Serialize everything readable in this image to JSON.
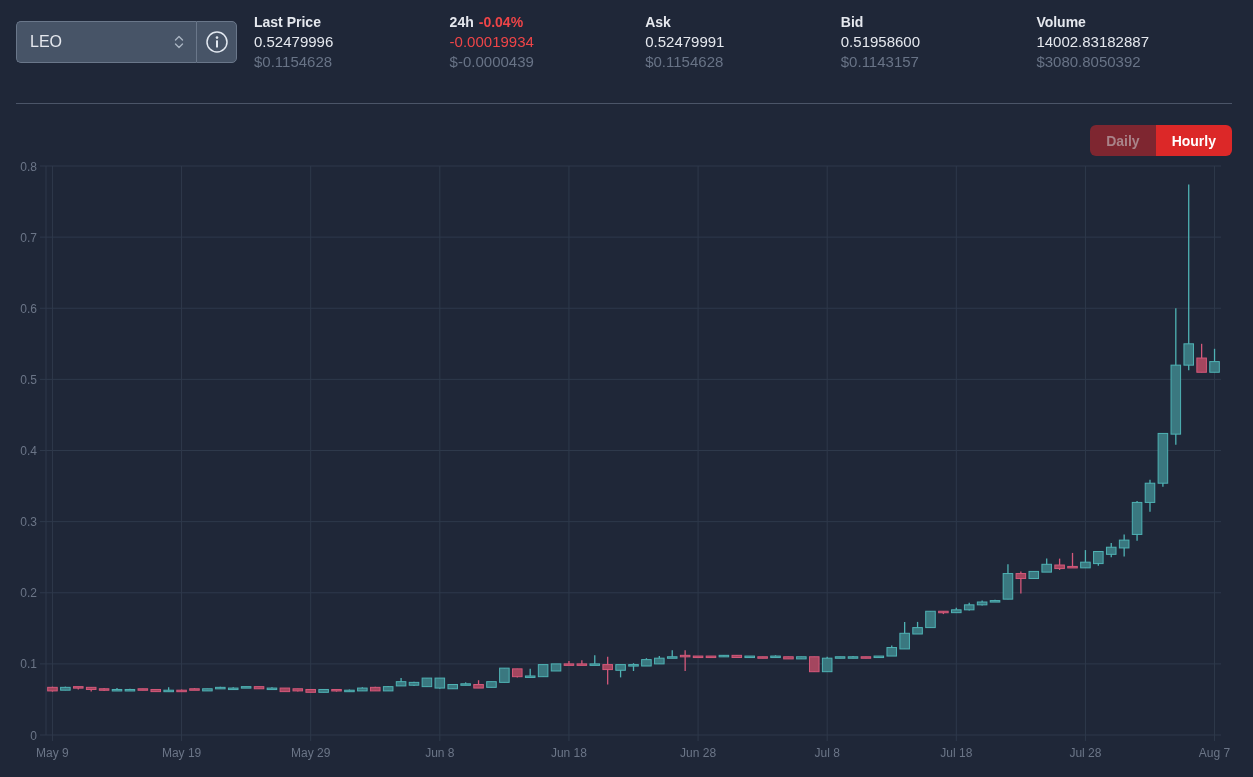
{
  "pair_selector": {
    "value": "LEO"
  },
  "stats": [
    {
      "label": "Last Price",
      "value": "0.52479996",
      "usd": "$0.1154628",
      "negative": false
    },
    {
      "label": "24h",
      "change": "-0.04%",
      "value": "-0.00019934",
      "usd": "$-0.0000439",
      "negative": true
    },
    {
      "label": "Ask",
      "value": "0.52479991",
      "usd": "$0.1154628",
      "negative": false
    },
    {
      "label": "Bid",
      "value": "0.51958600",
      "usd": "$0.1143157",
      "negative": false
    },
    {
      "label": "Volume",
      "value": "14002.83182887",
      "usd": "$3080.8050392",
      "negative": false
    }
  ],
  "interval_toggle": [
    {
      "label": "Daily",
      "selected": false
    },
    {
      "label": "Hourly",
      "selected": true
    }
  ],
  "chart": {
    "chart_data": {
      "type": "candlestick",
      "grid": true,
      "ylim": [
        0,
        0.8
      ],
      "yticks": [
        0,
        0.1,
        0.2,
        0.3,
        0.4,
        0.5,
        0.6,
        0.7,
        0.8
      ],
      "categories": [
        "May 9",
        null,
        null,
        null,
        null,
        null,
        null,
        null,
        null,
        null,
        "May 19",
        null,
        null,
        null,
        null,
        null,
        null,
        null,
        null,
        null,
        "May 29",
        null,
        null,
        null,
        null,
        null,
        null,
        null,
        null,
        null,
        "Jun 8",
        null,
        null,
        null,
        null,
        null,
        null,
        null,
        null,
        null,
        "Jun 18",
        null,
        null,
        null,
        null,
        null,
        null,
        null,
        null,
        null,
        "Jun 28",
        null,
        null,
        null,
        null,
        null,
        null,
        null,
        null,
        null,
        "Jul 8",
        null,
        null,
        null,
        null,
        null,
        null,
        null,
        null,
        null,
        "Jul 18",
        null,
        null,
        null,
        null,
        null,
        null,
        null,
        null,
        null,
        "Jul 28",
        null,
        null,
        null,
        null,
        null,
        null,
        null,
        null,
        null,
        "Aug 7"
      ],
      "ohlc": [
        [
          0.067,
          0.068,
          0.061,
          0.062
        ],
        [
          0.063,
          0.068,
          0.063,
          0.067
        ],
        [
          0.068,
          0.068,
          0.064,
          0.066
        ],
        [
          0.067,
          0.067,
          0.061,
          0.064
        ],
        [
          0.065,
          0.066,
          0.062,
          0.063
        ],
        [
          0.063,
          0.066,
          0.062,
          0.064
        ],
        [
          0.063,
          0.065,
          0.062,
          0.064
        ],
        [
          0.065,
          0.065,
          0.063,
          0.064
        ],
        [
          0.064,
          0.064,
          0.061,
          0.061
        ],
        [
          0.061,
          0.067,
          0.061,
          0.063
        ],
        [
          0.063,
          0.064,
          0.061,
          0.062
        ],
        [
          0.065,
          0.066,
          0.064,
          0.064
        ],
        [
          0.062,
          0.065,
          0.062,
          0.065
        ],
        [
          0.065,
          0.068,
          0.065,
          0.067
        ],
        [
          0.064,
          0.067,
          0.064,
          0.066
        ],
        [
          0.066,
          0.068,
          0.066,
          0.068
        ],
        [
          0.068,
          0.068,
          0.065,
          0.065
        ],
        [
          0.065,
          0.067,
          0.065,
          0.066
        ],
        [
          0.066,
          0.066,
          0.061,
          0.061
        ],
        [
          0.065,
          0.065,
          0.061,
          0.062
        ],
        [
          0.064,
          0.064,
          0.06,
          0.06
        ],
        [
          0.06,
          0.064,
          0.06,
          0.064
        ],
        [
          0.064,
          0.064,
          0.061,
          0.062
        ],
        [
          0.062,
          0.064,
          0.061,
          0.063
        ],
        [
          0.062,
          0.067,
          0.062,
          0.066
        ],
        [
          0.067,
          0.068,
          0.062,
          0.062
        ],
        [
          0.062,
          0.069,
          0.062,
          0.068
        ],
        [
          0.069,
          0.08,
          0.069,
          0.075
        ],
        [
          0.07,
          0.075,
          0.069,
          0.074
        ],
        [
          0.068,
          0.08,
          0.068,
          0.08
        ],
        [
          0.066,
          0.08,
          0.065,
          0.08
        ],
        [
          0.065,
          0.071,
          0.065,
          0.071
        ],
        [
          0.07,
          0.074,
          0.07,
          0.072
        ],
        [
          0.071,
          0.077,
          0.066,
          0.066
        ],
        [
          0.067,
          0.075,
          0.067,
          0.075
        ],
        [
          0.074,
          0.094,
          0.074,
          0.094
        ],
        [
          0.093,
          0.093,
          0.081,
          0.082
        ],
        [
          0.082,
          0.093,
          0.082,
          0.083
        ],
        [
          0.082,
          0.099,
          0.082,
          0.099
        ],
        [
          0.09,
          0.1,
          0.09,
          0.1
        ],
        [
          0.1,
          0.104,
          0.099,
          0.099
        ],
        [
          0.1,
          0.105,
          0.098,
          0.098
        ],
        [
          0.099,
          0.112,
          0.099,
          0.1
        ],
        [
          0.099,
          0.11,
          0.071,
          0.092
        ],
        [
          0.091,
          0.099,
          0.081,
          0.099
        ],
        [
          0.098,
          0.101,
          0.09,
          0.099
        ],
        [
          0.097,
          0.108,
          0.097,
          0.106
        ],
        [
          0.1,
          0.111,
          0.1,
          0.108
        ],
        [
          0.108,
          0.119,
          0.108,
          0.11
        ],
        [
          0.112,
          0.119,
          0.09,
          0.11
        ],
        [
          0.111,
          0.111,
          0.11,
          0.11
        ],
        [
          0.111,
          0.111,
          0.109,
          0.11
        ],
        [
          0.11,
          0.112,
          0.11,
          0.112
        ],
        [
          0.112,
          0.112,
          0.109,
          0.109
        ],
        [
          0.109,
          0.111,
          0.109,
          0.111
        ],
        [
          0.11,
          0.11,
          0.108,
          0.109
        ],
        [
          0.109,
          0.112,
          0.109,
          0.111
        ],
        [
          0.11,
          0.11,
          0.107,
          0.107
        ],
        [
          0.107,
          0.11,
          0.107,
          0.11
        ],
        [
          0.11,
          0.11,
          0.089,
          0.089
        ],
        [
          0.089,
          0.11,
          0.089,
          0.108
        ],
        [
          0.108,
          0.11,
          0.108,
          0.11
        ],
        [
          0.109,
          0.111,
          0.108,
          0.11
        ],
        [
          0.11,
          0.11,
          0.108,
          0.108
        ],
        [
          0.109,
          0.111,
          0.109,
          0.111
        ],
        [
          0.111,
          0.126,
          0.111,
          0.123
        ],
        [
          0.121,
          0.159,
          0.121,
          0.143
        ],
        [
          0.142,
          0.159,
          0.142,
          0.151
        ],
        [
          0.151,
          0.174,
          0.151,
          0.174
        ],
        [
          0.174,
          0.174,
          0.17,
          0.172
        ],
        [
          0.172,
          0.179,
          0.172,
          0.176
        ],
        [
          0.176,
          0.186,
          0.175,
          0.183
        ],
        [
          0.183,
          0.189,
          0.182,
          0.187
        ],
        [
          0.187,
          0.19,
          0.187,
          0.189
        ],
        [
          0.191,
          0.24,
          0.191,
          0.227
        ],
        [
          0.227,
          0.23,
          0.199,
          0.22
        ],
        [
          0.22,
          0.23,
          0.22,
          0.23
        ],
        [
          0.229,
          0.248,
          0.229,
          0.24
        ],
        [
          0.239,
          0.248,
          0.232,
          0.234
        ],
        [
          0.237,
          0.256,
          0.235,
          0.236
        ],
        [
          0.235,
          0.26,
          0.235,
          0.243
        ],
        [
          0.241,
          0.258,
          0.238,
          0.258
        ],
        [
          0.254,
          0.27,
          0.25,
          0.264
        ],
        [
          0.263,
          0.282,
          0.251,
          0.274
        ],
        [
          0.282,
          0.329,
          0.273,
          0.327
        ],
        [
          0.327,
          0.359,
          0.314,
          0.354
        ],
        [
          0.354,
          0.424,
          0.349,
          0.424
        ],
        [
          0.423,
          0.6,
          0.408,
          0.52
        ],
        [
          0.52,
          0.774,
          0.513,
          0.55
        ],
        [
          0.53,
          0.55,
          0.51,
          0.51
        ],
        [
          0.51,
          0.543,
          0.51,
          0.525
        ]
      ]
    }
  }
}
